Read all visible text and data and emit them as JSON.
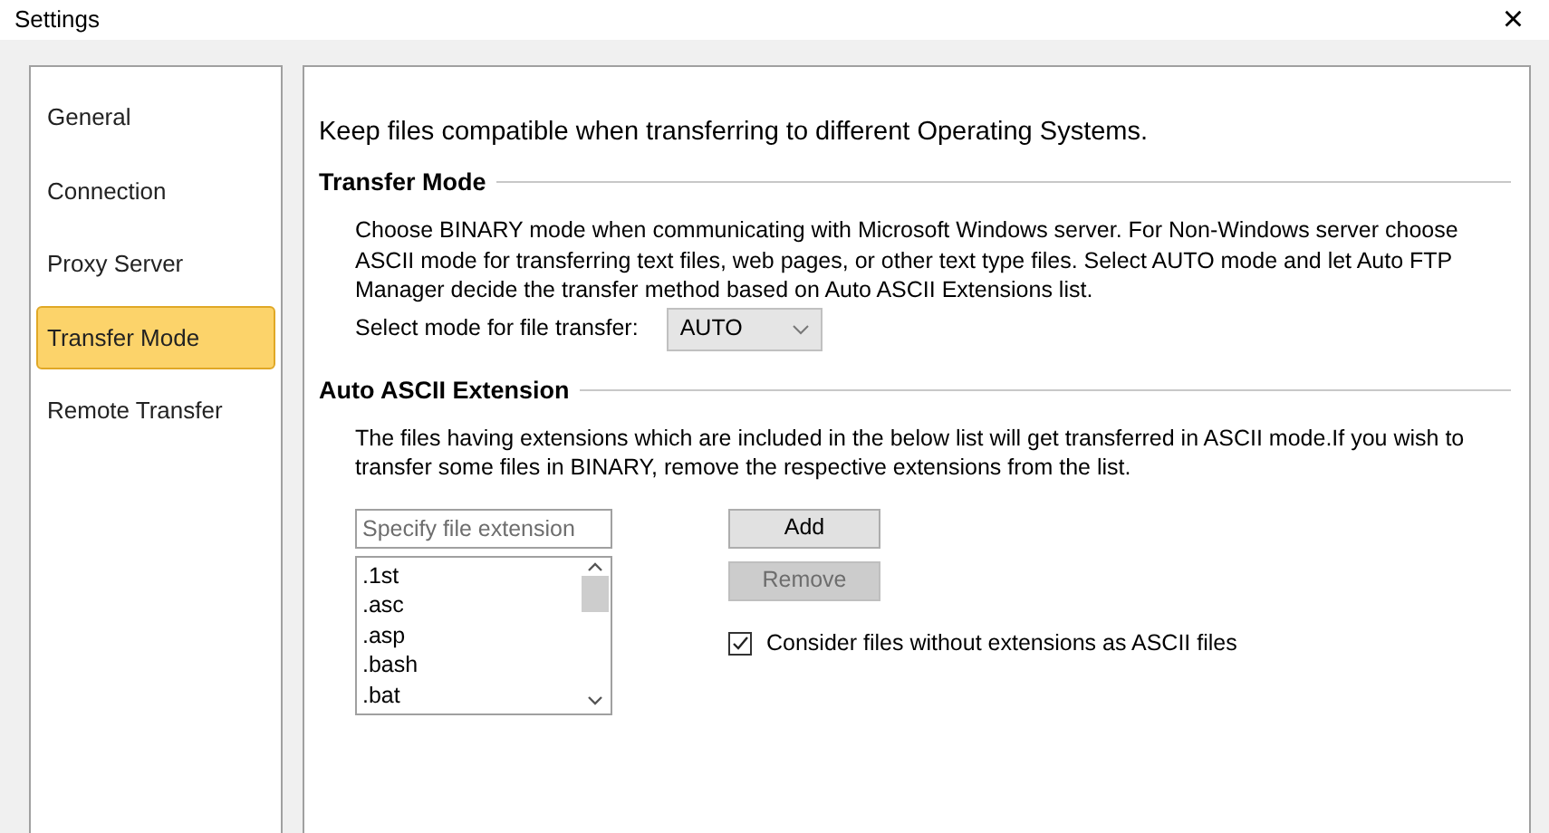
{
  "window": {
    "title": "Settings",
    "close": "×"
  },
  "sidebar": {
    "items": [
      {
        "label": "General",
        "selected": false
      },
      {
        "label": "Connection",
        "selected": false
      },
      {
        "label": "Proxy Server",
        "selected": false
      },
      {
        "label": "Transfer Mode",
        "selected": true
      },
      {
        "label": "Remote Transfer",
        "selected": false
      }
    ]
  },
  "intro": "Keep files compatible when transferring to different Operating Systems.",
  "transfer_mode": {
    "heading": "Transfer Mode",
    "description": "Choose BINARY mode when communicating with Microsoft Windows server. For Non-Windows server choose ASCII mode for transferring text files, web pages, or other text type files. Select AUTO mode and let Auto FTP Manager decide the transfer method based on Auto ASCII Extensions list.",
    "select_label": "Select mode for file transfer:",
    "select_value": "AUTO"
  },
  "auto_ascii": {
    "heading": "Auto ASCII Extension",
    "description": "The files having extensions which are included in the below list will get transferred in ASCII mode.If you wish to transfer some files in BINARY, remove the respective extensions from the list.",
    "extension_field": {
      "placeholder": "Specify file extension"
    },
    "extensions": [
      ".1st",
      ".asc",
      ".asp",
      ".bash",
      ".bat"
    ],
    "buttons": [
      {
        "label": "Add",
        "disabled": false
      },
      {
        "label": "Remove",
        "disabled": true
      }
    ],
    "checkbox": {
      "label": "Consider files without extensions as ASCII files",
      "checked": true
    }
  }
}
